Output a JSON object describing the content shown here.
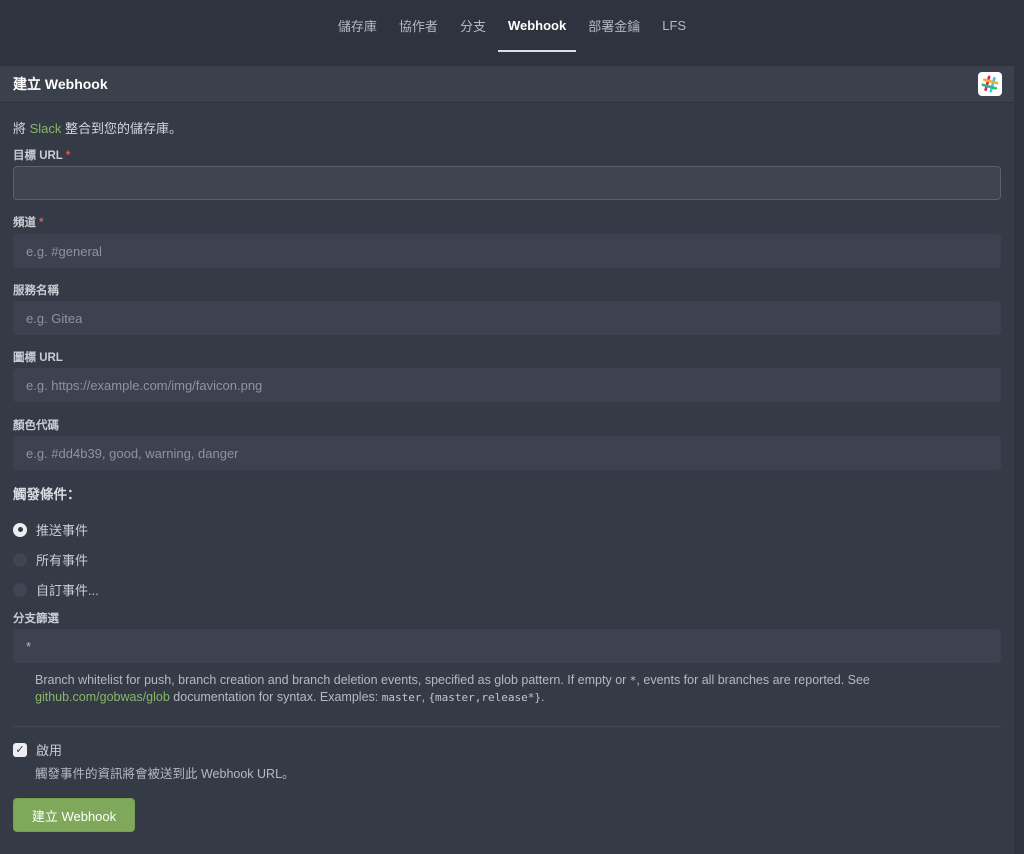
{
  "tabs": [
    {
      "label": "儲存庫"
    },
    {
      "label": "協作者"
    },
    {
      "label": "分支"
    },
    {
      "label": "Webhook"
    },
    {
      "label": "部署金鑰"
    },
    {
      "label": "LFS"
    }
  ],
  "active_tab": "Webhook",
  "header": {
    "title": "建立 Webhook",
    "logo_icon": "slack-icon"
  },
  "intro": {
    "prefix": "將 ",
    "link": "Slack",
    "suffix": " 整合到您的儲存庫。"
  },
  "fields": {
    "target_url": {
      "label": "目標 URL",
      "required_mark": "*",
      "value": "",
      "placeholder": ""
    },
    "channel": {
      "label": "頻道",
      "required_mark": "*",
      "placeholder": "e.g. #general"
    },
    "service_name": {
      "label": "服務名稱",
      "placeholder": "e.g. Gitea"
    },
    "icon_url": {
      "label": "圖標 URL",
      "placeholder": "e.g. https://example.com/img/favicon.png"
    },
    "color": {
      "label": "顏色代碼",
      "placeholder": "e.g. #dd4b39, good, warning, danger"
    }
  },
  "trigger": {
    "title": "觸發條件：",
    "options": [
      {
        "label": "推送事件",
        "checked": true
      },
      {
        "label": "所有事件",
        "checked": false
      },
      {
        "label": "自訂事件...",
        "checked": false
      }
    ]
  },
  "branch_filter": {
    "label": "分支篩選",
    "value": "*",
    "help_1": "Branch whitelist for push, branch creation and branch deletion events, specified as glob pattern. If empty or ",
    "help_star": "*",
    "help_2": ", events for all branches are reported. See ",
    "help_link": "github.com/gobwas/glob",
    "help_3": " documentation for syntax. Examples: ",
    "example_1": "master",
    "help_sep": ", ",
    "example_2": "{master,release*}",
    "help_end": "."
  },
  "active": {
    "label": "啟用",
    "checked": true,
    "help": "觸發事件的資訊將會被送到此 Webhook URL。"
  },
  "submit": {
    "label": "建立 Webhook"
  },
  "colors": {
    "accent_green": "#7fa85a",
    "link_green": "#89b667",
    "background": "#2f333f"
  }
}
